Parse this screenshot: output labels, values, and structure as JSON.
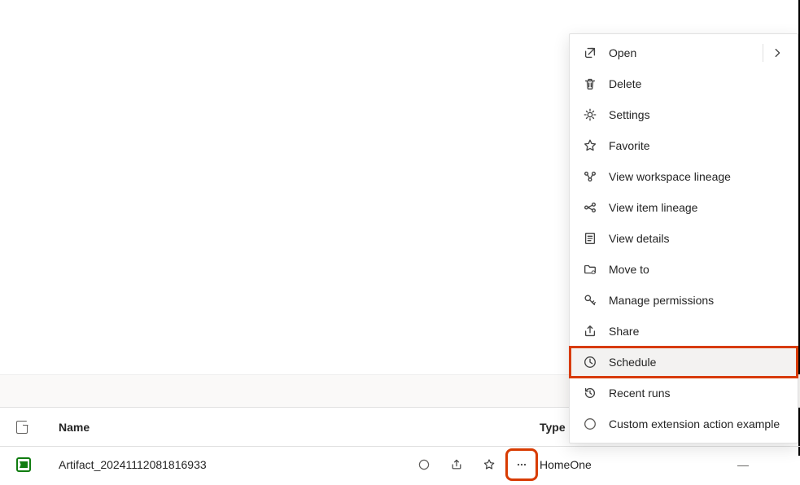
{
  "table": {
    "headers": {
      "name": "Name",
      "type": "Type"
    },
    "rows": [
      {
        "name": "Artifact_20241112081816933",
        "type": "HomeOne",
        "last": "—"
      }
    ]
  },
  "menu": {
    "items": [
      {
        "key": "open",
        "label": "Open",
        "has_submenu": true
      },
      {
        "key": "delete",
        "label": "Delete"
      },
      {
        "key": "settings",
        "label": "Settings"
      },
      {
        "key": "favorite",
        "label": "Favorite"
      },
      {
        "key": "workspace_lineage",
        "label": "View workspace lineage"
      },
      {
        "key": "item_lineage",
        "label": "View item lineage"
      },
      {
        "key": "view_details",
        "label": "View details"
      },
      {
        "key": "move_to",
        "label": "Move to"
      },
      {
        "key": "manage_permissions",
        "label": "Manage permissions"
      },
      {
        "key": "share",
        "label": "Share"
      },
      {
        "key": "schedule",
        "label": "Schedule"
      },
      {
        "key": "recent_runs",
        "label": "Recent runs"
      },
      {
        "key": "custom_ext",
        "label": "Custom extension action example"
      }
    ]
  },
  "icons": {
    "open": "open-icon",
    "delete": "trash-icon",
    "settings": "gear-icon",
    "favorite": "star-icon",
    "workspace_lineage": "lineage-workspace-icon",
    "item_lineage": "lineage-item-icon",
    "view_details": "details-icon",
    "move_to": "folder-move-icon",
    "manage_permissions": "key-icon",
    "share": "share-icon",
    "schedule": "clock-icon",
    "recent_runs": "history-icon",
    "custom_ext": "radio-icon"
  }
}
